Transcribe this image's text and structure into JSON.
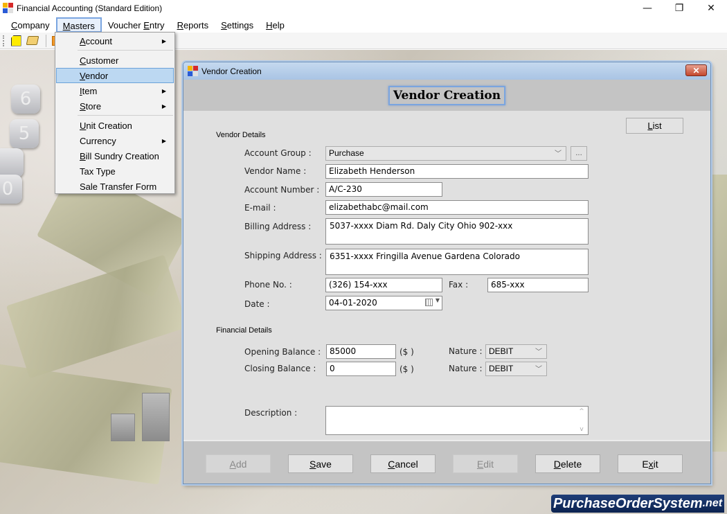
{
  "app": {
    "title": "Financial Accounting (Standard Edition)",
    "window_controls": {
      "minimize": "—",
      "restore": "❐",
      "close": "✕"
    }
  },
  "menubar": {
    "items": [
      {
        "label": "Company",
        "mnemonic": "C",
        "rest": "ompany"
      },
      {
        "label": "Masters",
        "mnemonic": "M",
        "rest": "asters"
      },
      {
        "label": "Voucher Entry",
        "pre": "Voucher ",
        "mnemonic": "E",
        "rest": "ntry"
      },
      {
        "label": "Reports",
        "mnemonic": "R",
        "rest": "eports"
      },
      {
        "label": "Settings",
        "mnemonic": "S",
        "rest": "ettings"
      },
      {
        "label": "Help",
        "mnemonic": "H",
        "rest": "elp"
      }
    ],
    "active": "Masters"
  },
  "toolbar": {
    "icons": [
      "new-document-icon",
      "open-folder-icon",
      "grid-icon"
    ]
  },
  "masters_menu": {
    "items": [
      {
        "mnemonic": "A",
        "rest": "ccount",
        "submenu": true
      },
      {
        "mnemonic": "C",
        "rest": "ustomer",
        "submenu": false
      },
      {
        "mnemonic": "V",
        "rest": "endor",
        "submenu": false,
        "highlighted": true
      },
      {
        "mnemonic": "I",
        "rest": "tem",
        "submenu": true
      },
      {
        "mnemonic": "S",
        "rest": "tore",
        "submenu": true
      },
      {
        "mnemonic": "U",
        "rest": "nit Creation",
        "submenu": false
      },
      {
        "mnemonic": "",
        "rest": "Currency",
        "submenu": true
      },
      {
        "mnemonic": "B",
        "rest": "ill Sundry Creation",
        "submenu": false
      },
      {
        "mnemonic": "",
        "rest": "Tax Type",
        "submenu": false
      },
      {
        "mnemonic": "",
        "rest": "Sale Transfer Form",
        "submenu": false
      }
    ],
    "submenu_arrow": "▶"
  },
  "dialog": {
    "title": "Vendor Creation",
    "heading": "Vendor Creation",
    "close_glyph": "✕",
    "list_button": {
      "mnemonic": "L",
      "rest": "ist"
    },
    "vendor_details": {
      "section_label": "Vendor Details",
      "account_group": {
        "label": "Account Group :",
        "value": "Purchase",
        "browse": "..."
      },
      "vendor_name": {
        "label": "Vendor Name :",
        "value": "Elizabeth Henderson"
      },
      "account_number": {
        "label": "Account Number :",
        "value": "A/C-230"
      },
      "email": {
        "label": "E-mail :",
        "value": "elizabethabc@mail.com"
      },
      "billing_address": {
        "label": "Billing Address :",
        "value": "5037-xxxx Diam Rd. Daly City Ohio 902-xxx"
      },
      "shipping_address": {
        "label": "Shipping Address :",
        "value": "6351-xxxx Fringilla Avenue Gardena Colorado"
      },
      "phone": {
        "label": "Phone No. :",
        "value": "(326) 154-xxx"
      },
      "fax": {
        "label": "Fax :",
        "value": "685-xxx"
      },
      "date": {
        "label": "Date :",
        "value": "04-01-2020"
      }
    },
    "financial_details": {
      "section_label": "Financial Details",
      "opening_balance": {
        "label": "Opening Balance :",
        "value": "85000",
        "currency": "($    )",
        "nature_label": "Nature :",
        "nature": "DEBIT"
      },
      "closing_balance": {
        "label": "Closing Balance :",
        "value": "0",
        "currency": "($    )",
        "nature_label": "Nature :",
        "nature": "DEBIT"
      }
    },
    "description": {
      "label": "Description :",
      "value": ""
    },
    "buttons": [
      {
        "id": "add",
        "mnemonic": "A",
        "rest": "dd",
        "enabled": false
      },
      {
        "id": "save",
        "mnemonic": "S",
        "rest": "ave",
        "enabled": true
      },
      {
        "id": "cancel",
        "mnemonic": "C",
        "rest": "ancel",
        "enabled": true
      },
      {
        "id": "edit",
        "mnemonic": "E",
        "rest": "dit",
        "enabled": false
      },
      {
        "id": "delete",
        "mnemonic": "D",
        "rest": "elete",
        "enabled": true
      },
      {
        "id": "exit",
        "pre": "E",
        "mnemonic": "x",
        "rest": "it",
        "enabled": true
      }
    ]
  },
  "watermark": {
    "main": "PurchaseOrderSystem",
    "tld": ".net"
  }
}
